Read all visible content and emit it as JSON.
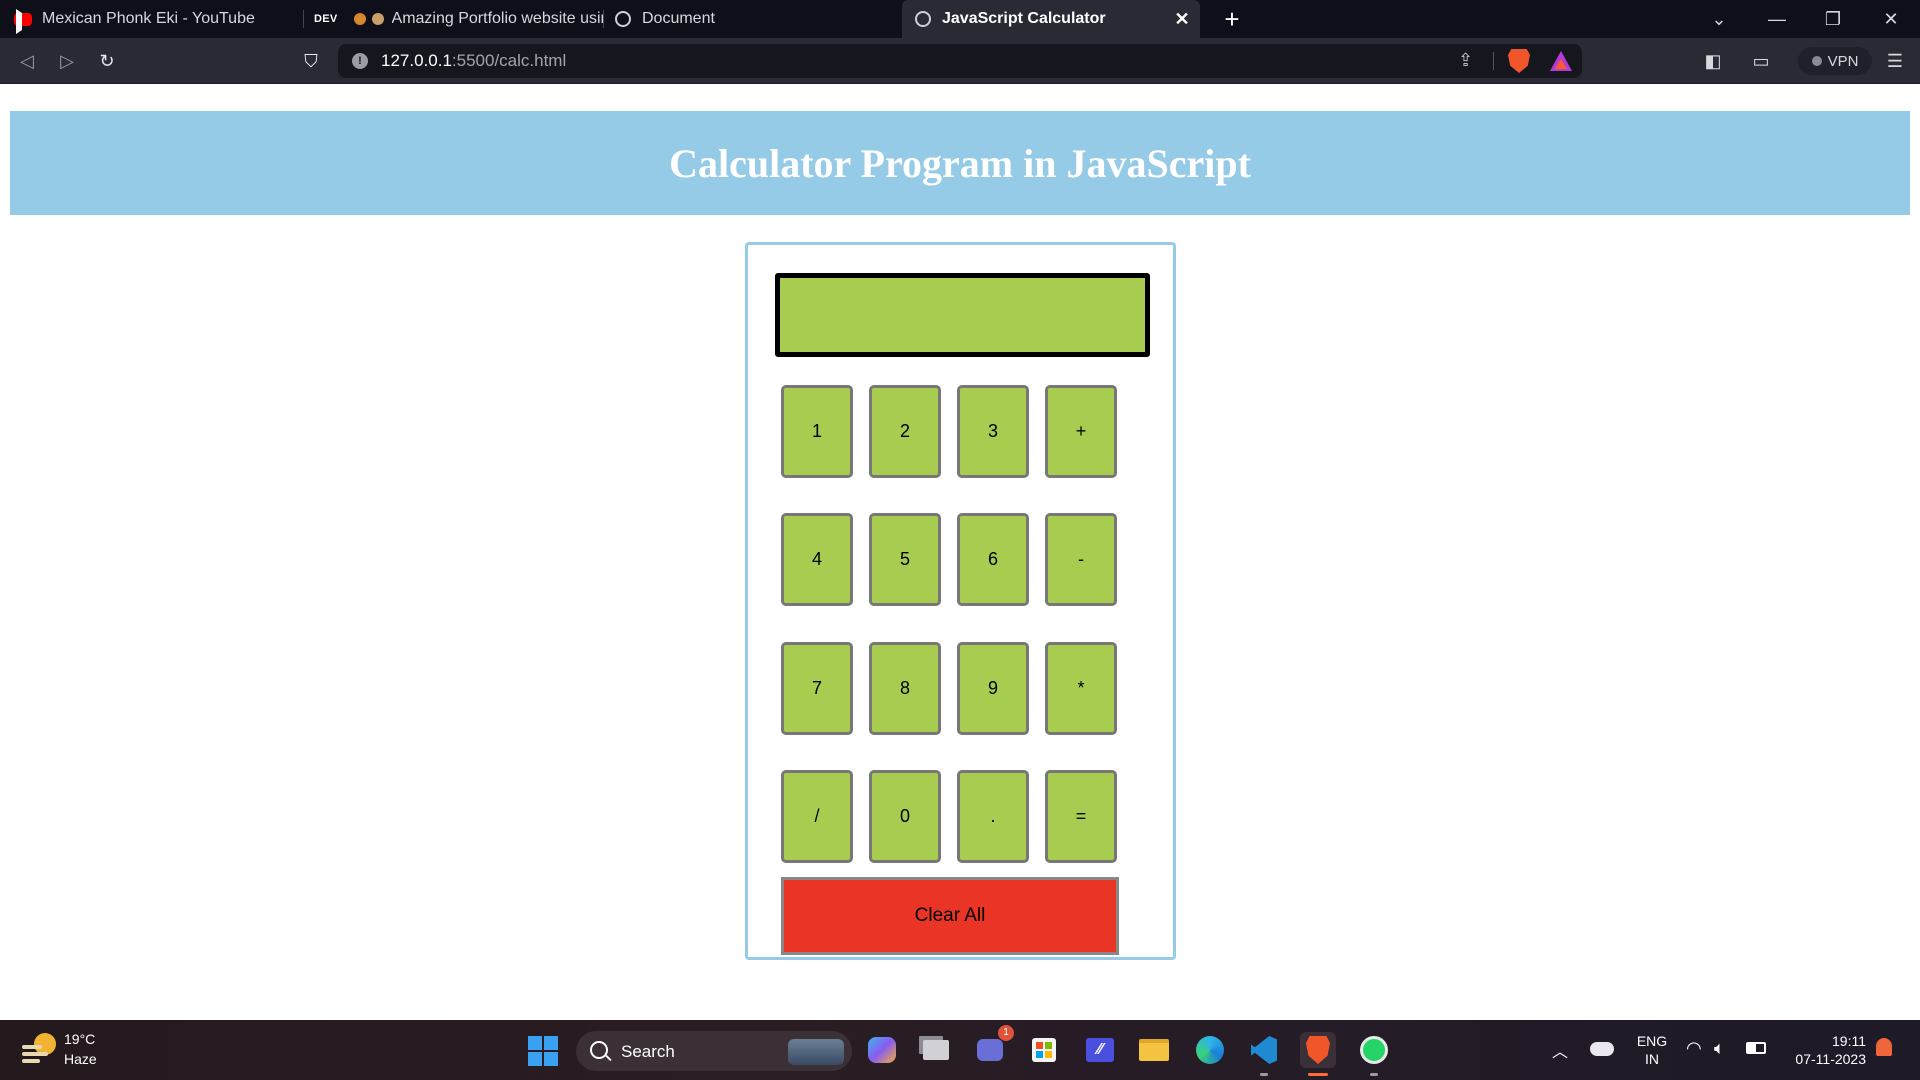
{
  "browser": {
    "tabs": [
      {
        "title": "Mexican Phonk Eki - YouTube"
      },
      {
        "prefix": "DEV",
        "title": "Amazing Portfolio website using"
      },
      {
        "title": "Document"
      },
      {
        "title": "JavaScript Calculator"
      }
    ],
    "url": {
      "host": "127.0.0.1",
      "path": ":5500/calc.html"
    },
    "vpn_label": "VPN"
  },
  "page": {
    "title": "Calculator Program in JavaScript"
  },
  "calculator": {
    "display_value": "",
    "rows": [
      [
        "1",
        "2",
        "3",
        "+"
      ],
      [
        "4",
        "5",
        "6",
        "-"
      ],
      [
        "7",
        "8",
        "9",
        "*"
      ],
      [
        "/",
        "0",
        ".",
        "="
      ]
    ],
    "clear_label": "Clear All",
    "colors": {
      "key": "#a7cc4f",
      "clear": "#e93426",
      "border": "#95cbe7"
    }
  },
  "taskbar": {
    "weather": {
      "temp": "19°C",
      "desc": "Haze"
    },
    "search_label": "Search",
    "teams_badge": "1",
    "lang": {
      "line1": "ENG",
      "line2": "IN"
    },
    "clock": {
      "time": "19:11",
      "date": "07-11-2023"
    }
  }
}
